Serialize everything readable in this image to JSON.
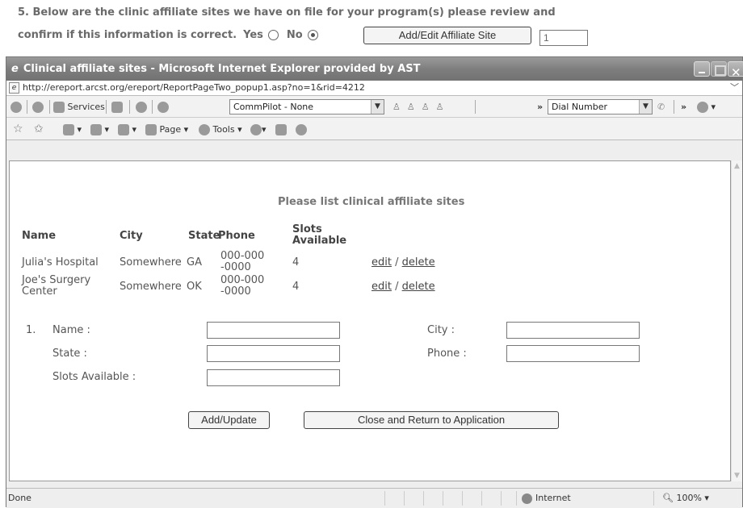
{
  "question": {
    "line1": "5. Below are the clinic affiliate sites we have on file for your program(s) please review and",
    "line2": "confirm if this information is correct.",
    "yes_label": "Yes",
    "no_label": "No",
    "selected": "No",
    "add_edit_button": "Add/Edit Affiliate Site",
    "count_value": "1"
  },
  "window": {
    "title": "Clinical affiliate sites - Microsoft Internet Explorer provided by AST",
    "url": "http://ereport.arcst.org/ereport/ReportPageTwo_popup1.asp?no=1&rid=4212",
    "toolbar": {
      "services": "Services",
      "commpilot": "CommPilot - None",
      "chevron": "»",
      "dial_number": "Dial Number"
    },
    "cmdbar": {
      "page": "Page",
      "tools": "Tools"
    },
    "status": {
      "text": "Done",
      "zone": "Internet",
      "zoom": "100%"
    }
  },
  "page": {
    "heading": "Please list clinical affiliate sites",
    "columns": [
      "Name",
      "City",
      "State",
      "Phone",
      "Slots Available"
    ],
    "rows": [
      {
        "name": "Julia's Hospital",
        "city": "Somewhere",
        "state": "GA",
        "phone": "000-000-0000",
        "slots": "4",
        "edit": "edit",
        "delete": "delete"
      },
      {
        "name": "Joe's Surgery Center",
        "city": "Somewhere",
        "state": "OK",
        "phone": "000-000-0000",
        "slots": "4",
        "edit": "edit",
        "delete": "delete"
      }
    ],
    "form": {
      "index": "1.",
      "name_label": "Name :",
      "city_label": "City :",
      "state_label": "State :",
      "phone_label": "Phone :",
      "slots_label": "Slots Available :"
    },
    "add_update_button": "Add/Update",
    "close_button": "Close and Return to Application"
  }
}
